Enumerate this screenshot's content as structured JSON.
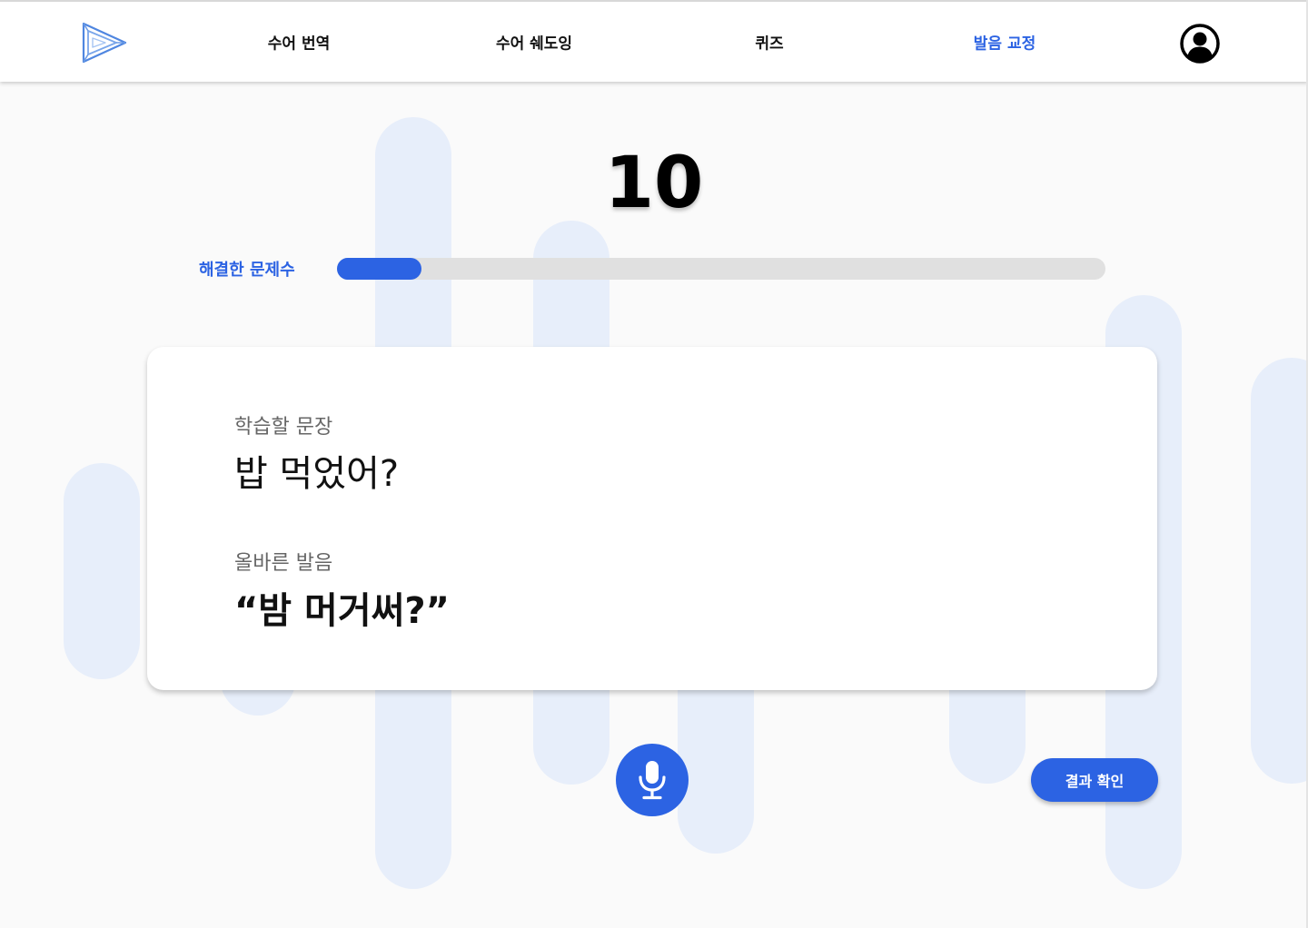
{
  "nav": {
    "items": [
      {
        "label": "수어 번역",
        "active": false
      },
      {
        "label": "수어 쉐도잉",
        "active": false
      },
      {
        "label": "퀴즈",
        "active": false
      },
      {
        "label": "발음 교정",
        "active": true
      }
    ],
    "logo_icon": "play-triangle-logo-icon",
    "profile_icon": "user-circle-icon"
  },
  "progress": {
    "count": "10",
    "label": "해결한 문제수",
    "fraction": 0.11
  },
  "card": {
    "sentence_label": "학습할 문장",
    "sentence": "밥 먹었어?",
    "pron_label": "올바른 발음",
    "pronunciation": "“밤 머거써?”"
  },
  "actions": {
    "mic_icon": "microphone-icon",
    "result_label": "결과 확인"
  },
  "colors": {
    "accent": "#2c63e3",
    "background": "#fafafa",
    "decor": "#e7eefa",
    "track": "#e0e0e0"
  }
}
